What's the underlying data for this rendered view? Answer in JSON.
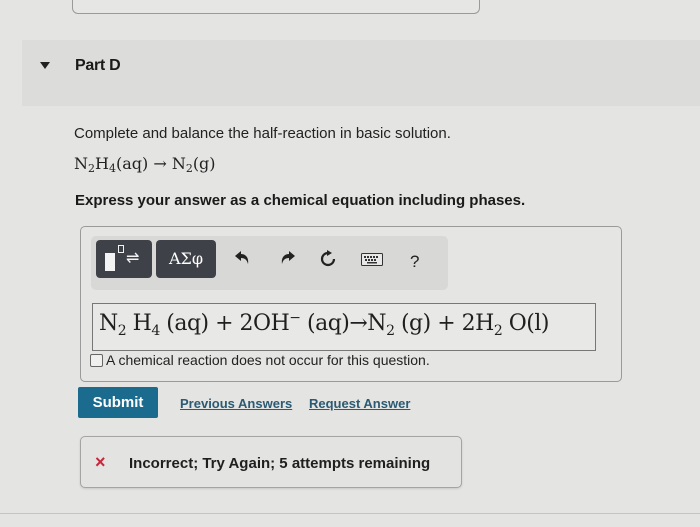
{
  "part": {
    "title": "Part D",
    "expanded": true
  },
  "question": {
    "instruction": "Complete and balance the half-reaction in basic solution.",
    "reaction": {
      "reactant_base": "N",
      "reactant_sub1": "2",
      "reactant_mid": "H",
      "reactant_sub2": "4",
      "reactant_phase": "(aq)",
      "arrow": "→",
      "product_base": "N",
      "product_sub": "2",
      "product_phase": "(g)"
    },
    "express": "Express your answer as a chemical equation including phases."
  },
  "toolbar": {
    "templates_icon": "template-arrows-icon",
    "greek_label": "ΑΣφ",
    "undo_icon": "undo-icon",
    "redo_icon": "redo-icon",
    "reset_icon": "reset-icon",
    "keyboard_icon": "keyboard-icon",
    "help_label": "?"
  },
  "answer": {
    "t1": "N",
    "s1": "2",
    "t2": " H",
    "s2": "4",
    "t3": " (aq) + 2OH",
    "sup1": "−",
    "t4": " (aq)→N",
    "s3": "2",
    "t5": " (g) + 2H",
    "s4": "2",
    "t6": " O(l)"
  },
  "no_reaction": {
    "label": "A chemical reaction does not occur for this question.",
    "checked": false
  },
  "actions": {
    "submit": "Submit",
    "previous_answers": "Previous Answers",
    "request_answer": "Request Answer"
  },
  "feedback": {
    "icon": "×",
    "text": "Incorrect; Try Again; 5 attempts remaining",
    "color": "#c8263a"
  },
  "colors": {
    "submit_bg": "#1b6b8f",
    "link": "#2b5a72",
    "toolbar_button": "#3e4147"
  }
}
